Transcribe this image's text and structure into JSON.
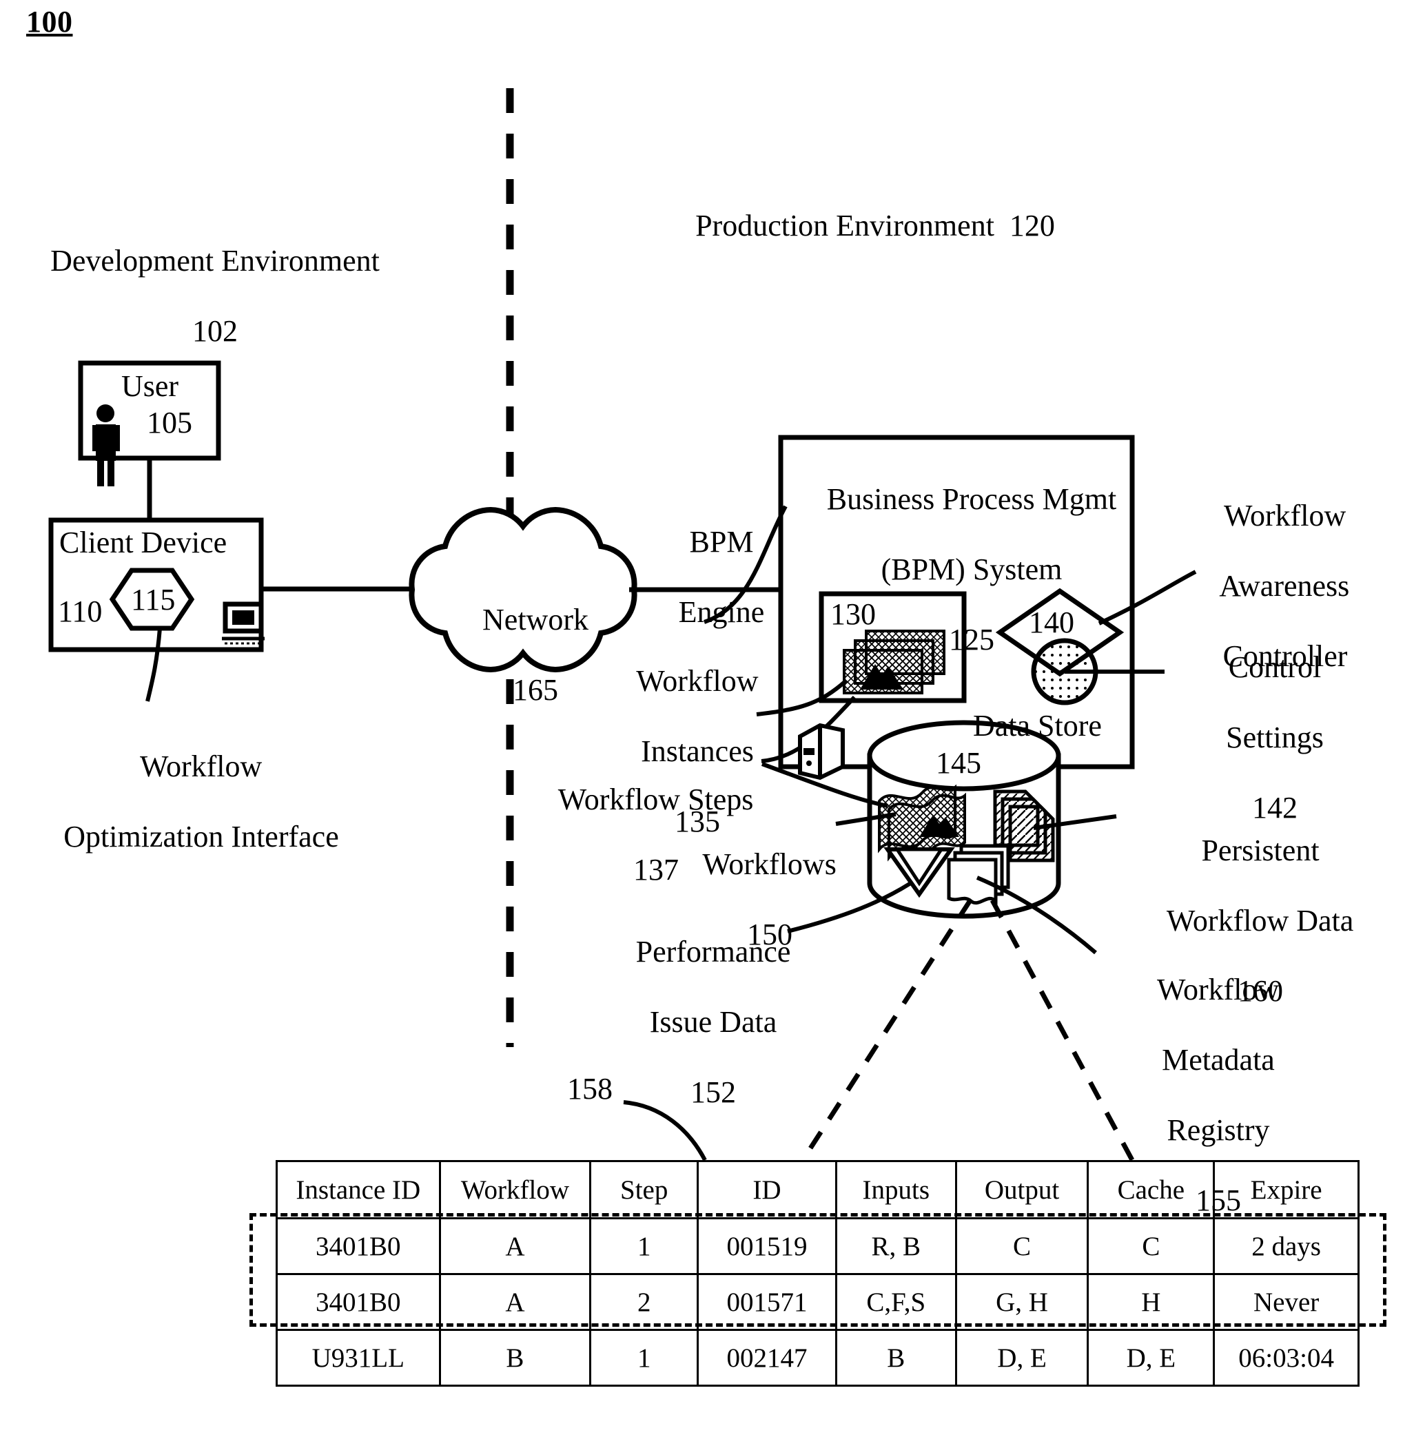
{
  "figure": {
    "number": "100"
  },
  "environments": {
    "development": {
      "name": "Development Environment",
      "ref": "102"
    },
    "production": {
      "name": "Production Environment  120"
    }
  },
  "nodes": {
    "user": {
      "label": "User",
      "ref": "105",
      "icon": "person-icon"
    },
    "client_device": {
      "label": "Client Device",
      "ref": "110",
      "interface_ref": "115",
      "icon": "monitor-icon"
    },
    "workflow_optimization_interface": {
      "line1": "Workflow",
      "line2": "Optimization Interface"
    },
    "network": {
      "label": "Network",
      "ref": "165"
    },
    "bpm_system": {
      "line1": "Business Process Mgmt",
      "line2": "(BPM) System",
      "ref": "125"
    },
    "bpm_engine": {
      "line1": "BPM",
      "line2": "Engine",
      "ref": "130"
    },
    "workflow_instances": {
      "line1": "Workflow",
      "line2": "Instances",
      "ref": "135"
    },
    "workflow_steps": {
      "label": "Workflow Steps",
      "ref": "137"
    },
    "workflow_awareness_controller": {
      "line1": "Workflow",
      "line2": "Awareness",
      "line3": "Controller",
      "ref": "140"
    },
    "control_settings": {
      "line1": "Control",
      "line2": "Settings",
      "ref": "142"
    },
    "data_store": {
      "label": "Data Store",
      "ref": "145"
    },
    "workflows": {
      "label": "Workflows",
      "ref": "150"
    },
    "performance_issue_data": {
      "line1": "Performance",
      "line2": "Issue Data",
      "ref": "152"
    },
    "workflow_metadata_registry": {
      "line1": "Workflow",
      "line2": "Metadata",
      "line3": "Registry",
      "ref": "155"
    },
    "persistent_workflow_data": {
      "line1": "Persistent",
      "line2": "Workflow Data",
      "ref": "160"
    },
    "registry_table": {
      "ref": "158"
    }
  },
  "table": {
    "columns": [
      "Instance ID",
      "Workflow",
      "Step",
      "ID",
      "Inputs",
      "Output",
      "Cache",
      "Expire"
    ],
    "rows": [
      {
        "highlighted": true,
        "cells": [
          "3401B0",
          "A",
          "1",
          "001519",
          "R, B",
          "C",
          "C",
          "2 days"
        ]
      },
      {
        "highlighted": true,
        "cells": [
          "3401B0",
          "A",
          "2",
          "001571",
          "C,F,S",
          "G, H",
          "H",
          "Never"
        ]
      },
      {
        "highlighted": false,
        "cells": [
          "U931LL",
          "B",
          "1",
          "002147",
          "B",
          "D, E",
          "D, E",
          "06:03:04"
        ]
      }
    ]
  },
  "colors": {
    "ink": "#000000",
    "paper": "#ffffff"
  }
}
